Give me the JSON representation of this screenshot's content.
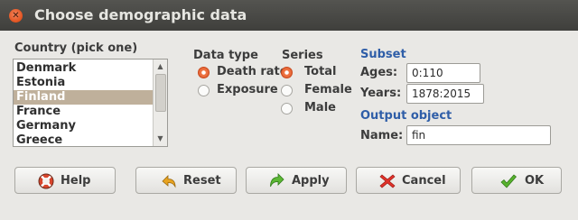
{
  "window": {
    "title": "Choose demographic data",
    "close_glyph": "✕"
  },
  "country": {
    "label": "Country (pick one)",
    "items": [
      "Denmark",
      "Estonia",
      "Finland",
      "France",
      "Germany",
      "Greece"
    ],
    "selected": "Finland"
  },
  "data_type": {
    "label": "Data type",
    "options": [
      {
        "label": "Death rate",
        "checked": true
      },
      {
        "label": "Exposure",
        "checked": false
      }
    ]
  },
  "series": {
    "label": "Series",
    "options": [
      {
        "label": "Total",
        "checked": true
      },
      {
        "label": "Female",
        "checked": false
      },
      {
        "label": "Male",
        "checked": false
      }
    ]
  },
  "subset": {
    "label": "Subset",
    "ages_label": "Ages:",
    "ages_value": "0:110",
    "years_label": "Years:",
    "years_value": "1878:2015"
  },
  "output": {
    "label": "Output object",
    "name_label": "Name:",
    "name_value": "fin"
  },
  "buttons": {
    "help": "Help",
    "reset": "Reset",
    "apply": "Apply",
    "cancel": "Cancel",
    "ok": "OK"
  },
  "icons": {
    "help": "lifebuoy-icon",
    "reset": "undo-arrow-icon",
    "apply": "redo-arrow-icon",
    "cancel": "red-x-icon",
    "ok": "green-checkmark-icon"
  },
  "colors": {
    "accent_orange": "#dd5628",
    "section_blue": "#2f5ea8",
    "selection": "#bfb09b",
    "titlebar": "#4a4a47"
  }
}
